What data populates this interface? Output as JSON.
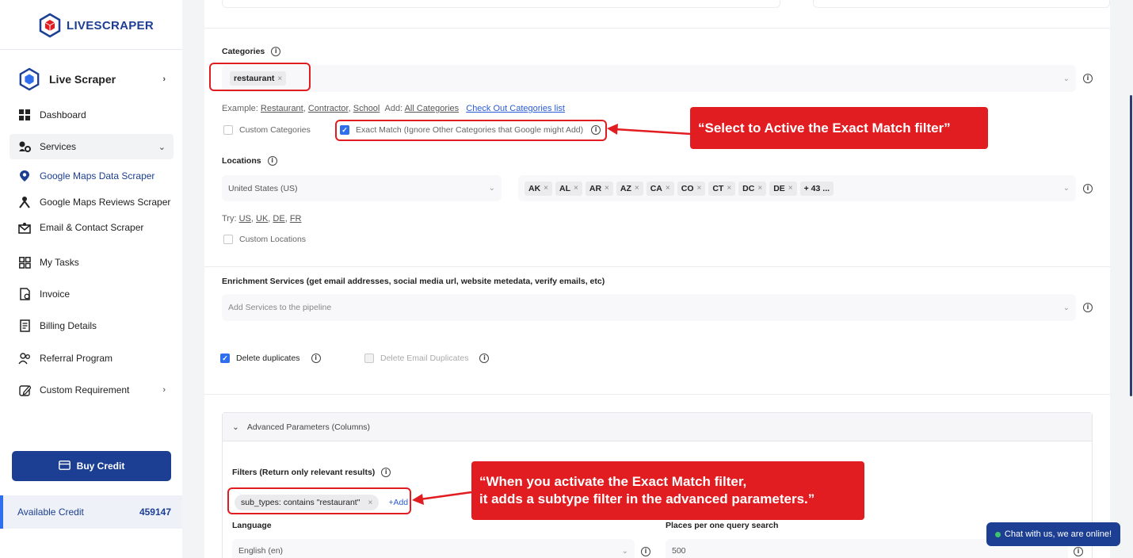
{
  "brand": {
    "name": "LIVESCRAPER"
  },
  "sidebar": {
    "header": "Live Scraper",
    "items": [
      {
        "label": "Dashboard",
        "icon": "grid-icon"
      },
      {
        "label": "Services",
        "icon": "services-icon"
      },
      {
        "label": "Google Maps Data Scraper",
        "icon": "map-pin-icon"
      },
      {
        "label": "Google Maps Reviews Scraper",
        "icon": "reviews-icon"
      },
      {
        "label": "Email & Contact Scraper",
        "icon": "mail-icon"
      },
      {
        "label": "My Tasks",
        "icon": "tasks-icon"
      },
      {
        "label": "Invoice",
        "icon": "invoice-icon"
      },
      {
        "label": "Billing Details",
        "icon": "billing-icon"
      },
      {
        "label": "Referral Program",
        "icon": "referral-icon"
      },
      {
        "label": "Custom Requirement",
        "icon": "edit-icon"
      }
    ],
    "buy_label": "Buy Credit",
    "credit_label": "Available Credit",
    "credit_value": "459147"
  },
  "categories": {
    "label": "Categories",
    "chip": "restaurant",
    "example_prefix": "Example:",
    "examples": [
      "Restaurant",
      "Contractor",
      "School"
    ],
    "add_prefix": "Add:",
    "add_all": "All Categories",
    "check_list": "Check Out Categories list",
    "custom_label": "Custom Categories",
    "exact_label": "Exact Match (Ignore Other Categories that Google might Add)"
  },
  "locations": {
    "label": "Locations",
    "country": "United States (US)",
    "states": [
      "AK",
      "AL",
      "AR",
      "AZ",
      "CA",
      "CO",
      "CT",
      "DC",
      "DE"
    ],
    "more": "+ 43 ...",
    "try_prefix": "Try:",
    "try": [
      "US",
      "UK",
      "DE",
      "FR"
    ],
    "custom_label": "Custom Locations"
  },
  "enrichment": {
    "label": "Enrichment Services (get email addresses, social media url, website metedata, verify emails, etc)",
    "placeholder": "Add Services to the pipeline"
  },
  "options": {
    "delete_duplicates": "Delete duplicates",
    "delete_email_duplicates": "Delete Email Duplicates"
  },
  "advanced": {
    "title": "Advanced Parameters (Columns)",
    "filters_label": "Filters (Return only relevant results)",
    "filter_chip": "sub_types: contains \"restaurant\"",
    "add_label": "+Add",
    "language_label": "Language",
    "language_value": "English (en)",
    "places_label": "Places per one query search",
    "places_value": "500"
  },
  "annotations": {
    "exact_match": "“Select to Active the Exact Match filter”",
    "subtype_line1": "“When you activate the Exact Match filter,",
    "subtype_line2": "it adds a subtype filter in the advanced parameters.”"
  },
  "chat": {
    "label": "Chat with us, we are online!"
  },
  "colors": {
    "brand": "#1c3f94",
    "accent": "#2f6fed",
    "callout": "#e11d21"
  }
}
